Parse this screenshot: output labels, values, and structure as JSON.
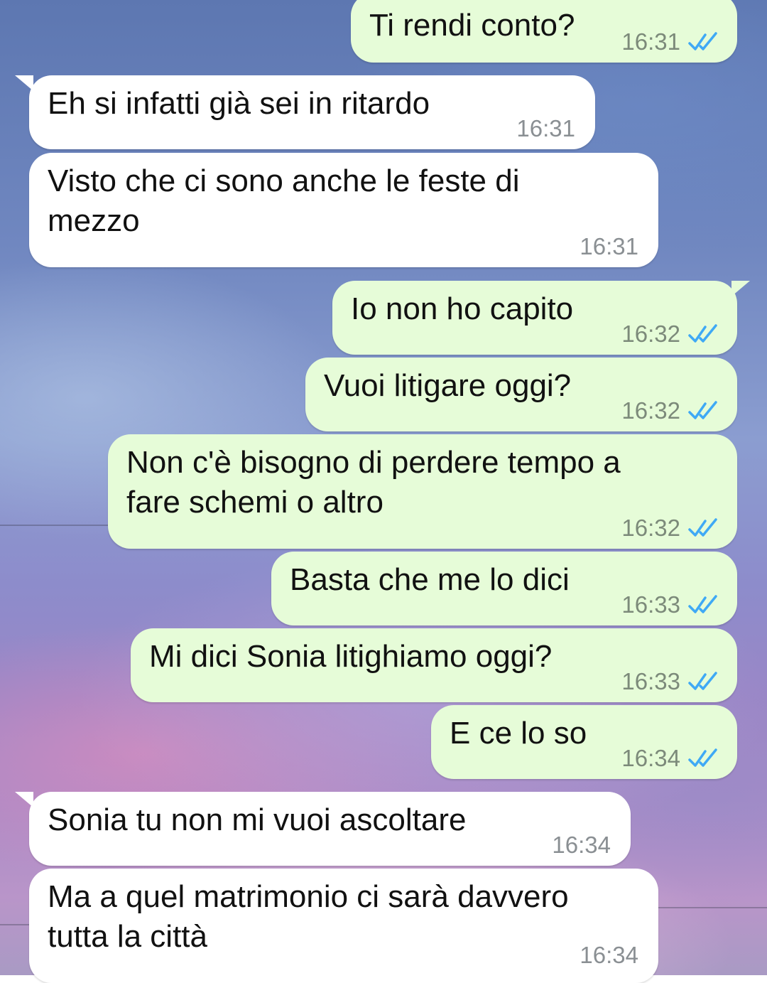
{
  "colors": {
    "outgoing_bubble": "#e6fcd8",
    "incoming_bubble": "#ffffff",
    "read_tick": "#3fa9f5"
  },
  "messages": [
    {
      "direction": "out",
      "text": "Ti rendi conto?",
      "time": "16:31",
      "status": "read"
    },
    {
      "direction": "in",
      "text": "Eh si infatti già sei in ritardo",
      "time": "16:31"
    },
    {
      "direction": "in",
      "text_lines": [
        "Visto che ci sono anche le feste di",
        "mezzo"
      ],
      "time": "16:31"
    },
    {
      "direction": "out",
      "text": "Io non ho capito",
      "time": "16:32",
      "status": "read"
    },
    {
      "direction": "out",
      "text": "Vuoi litigare oggi?",
      "time": "16:32",
      "status": "read"
    },
    {
      "direction": "out",
      "text_lines": [
        "Non c'è bisogno di perdere tempo a",
        "fare schemi o altro"
      ],
      "time": "16:32",
      "status": "read"
    },
    {
      "direction": "out",
      "text": "Basta che me lo dici",
      "time": "16:33",
      "status": "read"
    },
    {
      "direction": "out",
      "text": "Mi dici Sonia litighiamo oggi?",
      "time": "16:33",
      "status": "read"
    },
    {
      "direction": "out",
      "text": "E ce lo so",
      "time": "16:34",
      "status": "read"
    },
    {
      "direction": "in",
      "text": "Sonia tu non mi vuoi ascoltare",
      "time": "16:34"
    },
    {
      "direction": "in",
      "text_lines": [
        "Ma a quel matrimonio ci sarà davvero",
        "tutta la città"
      ],
      "time": "16:34"
    }
  ],
  "icons": {
    "read_receipt": "double-check-icon"
  }
}
